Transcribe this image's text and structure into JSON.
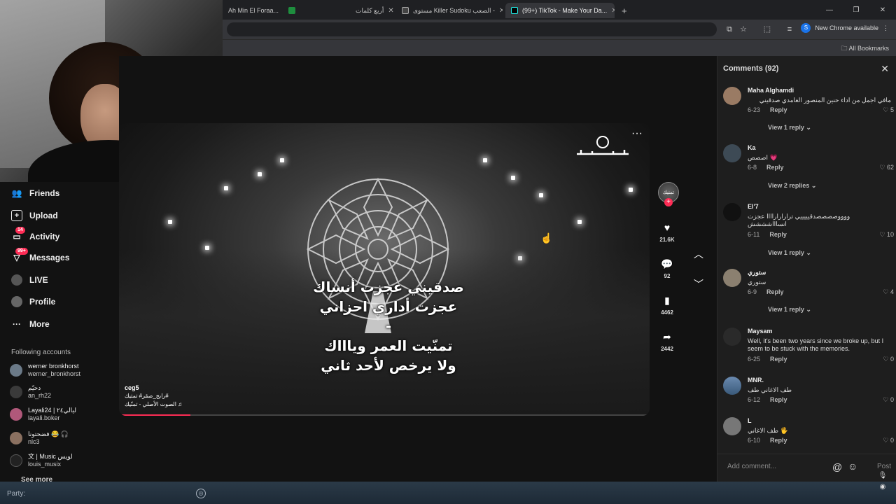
{
  "browser": {
    "tabs": [
      {
        "label": "Ah Min El Foraa...",
        "active": false
      },
      {
        "label": "",
        "active": false,
        "icon": "sheets-icon"
      },
      {
        "label": "أربع كلمات",
        "active": false
      },
      {
        "label": "مستوى Killer Sudoku الصعب -",
        "active": false
      },
      {
        "label": "(99+) TikTok - Make Your Da...",
        "active": true
      }
    ],
    "new_chrome": "New Chrome available",
    "profile_initial": "S",
    "all_bookmarks": "All Bookmarks"
  },
  "sidebar": {
    "items": [
      {
        "label": "Friends",
        "icon": "friends-icon"
      },
      {
        "label": "Upload",
        "icon": "upload-icon"
      },
      {
        "label": "Activity",
        "icon": "activity-icon",
        "badge": "14"
      },
      {
        "label": "Messages",
        "icon": "messages-icon",
        "badge": "99+"
      },
      {
        "label": "LIVE",
        "icon": "live-icon"
      },
      {
        "label": "Profile",
        "icon": "profile-icon"
      },
      {
        "label": "More",
        "icon": "more-icon"
      }
    ],
    "following_title": "Following accounts",
    "following": [
      {
        "name": "werner bronkhorst",
        "handle": "werner_bronkhorst"
      },
      {
        "name": "دحيّم",
        "handle": "an_rh22"
      },
      {
        "name": "Layali24 | ليالي٢٤",
        "handle": "layali.boker"
      },
      {
        "name": "فضحتونا 😂 🎧",
        "handle": "nlc3"
      },
      {
        "name": "文 | Music لويس",
        "handle": "louis_musix"
      }
    ],
    "see_more": "See more"
  },
  "video": {
    "lyrics": [
      "صدقيني عجزت أنساك",
      "عجزت أداري احزاني",
      "-",
      "تمنّيت العمر وياااك",
      "ولا يرخص لأحد ثاني"
    ],
    "user": "ceg5",
    "hashtags": "رابح_صقر# تمتيك#",
    "sound": "الصوت الأصلي - تمنّيك ♫",
    "progress": 0.135,
    "more": "···"
  },
  "actions": {
    "likes": "21.6K",
    "comments": "92",
    "saves": "4462",
    "shares": "2442",
    "creator_label": "تمنيك"
  },
  "comments": {
    "title": "Comments (92)",
    "items": [
      {
        "name": "Maha Alghamdi",
        "text": "مافي اجمل من اداء حنين المنصور الغامدي صدقيني",
        "date": "6-23",
        "likes": "5",
        "replies": "View 1 reply"
      },
      {
        "name": "Ka",
        "text": "اصصص 💗",
        "date": "6-8",
        "likes": "62",
        "replies": "View 2 replies"
      },
      {
        "name": "El'7",
        "text": "ووووصصصصدقيييييي تراراراراااا عجزت انساااشششش",
        "date": "6-11",
        "likes": "10",
        "replies": "View 1 reply"
      },
      {
        "name": "ستوري",
        "text": "ستوري",
        "date": "6-9",
        "likes": "4",
        "replies": "View 1 reply"
      },
      {
        "name": "Maysam",
        "text": "Well, it's been two years since we broke up, but I seem to be stuck with the memories.",
        "date": "6-25",
        "likes": "0",
        "replies": ""
      },
      {
        "name": "MNR.",
        "text": "طف الاغاني طف",
        "date": "6-12",
        "likes": "0",
        "replies": ""
      },
      {
        "name": "L",
        "text": "طف الاغاني 🖐",
        "date": "6-10",
        "likes": "0",
        "replies": ""
      }
    ],
    "reply_label": "Reply",
    "add_placeholder": "Add comment...",
    "post_label": "Post"
  },
  "bottom": {
    "party_label": "Party:"
  }
}
